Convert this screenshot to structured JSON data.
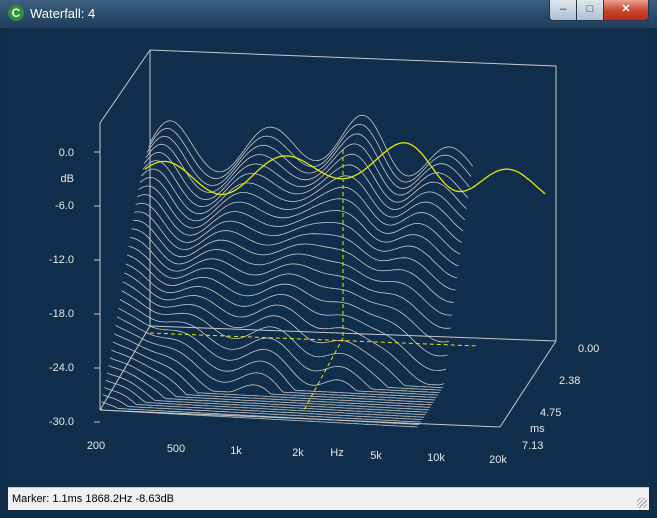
{
  "window": {
    "title": "Waterfall: 4"
  },
  "controls": {
    "minimize": "‒",
    "maximize": "□",
    "close": "✕"
  },
  "plot": {
    "db_ticks": [
      "0.0",
      "-6.0",
      "-12.0",
      "-18.0",
      "-24.0",
      "-30.0"
    ],
    "db_label": "dB",
    "freq_ticks": [
      "200",
      "500",
      "1k",
      "2k",
      "5k",
      "10k",
      "20k"
    ],
    "freq_label": "Hz",
    "time_ticks": [
      "0.00",
      "2.38",
      "4.75",
      "7.13"
    ],
    "time_label": "ms",
    "colors": {
      "trace": "#c8c8c8",
      "marker": "#e6e600",
      "background": "#102e4b"
    }
  },
  "status": {
    "text": "Marker:  1.1ms  1868.2Hz  -8.63dB"
  }
}
